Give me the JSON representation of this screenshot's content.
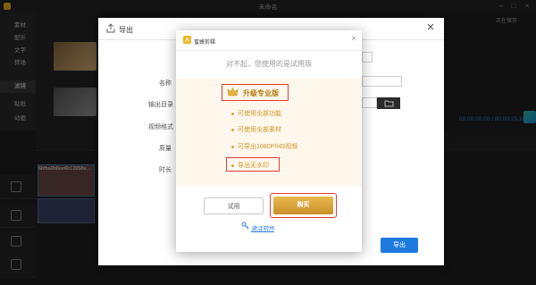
{
  "app": {
    "window_title": "未命名"
  },
  "sidebar": {
    "items": [
      {
        "label": "素材"
      },
      {
        "label": "配乐"
      },
      {
        "label": "文字"
      },
      {
        "label": "转场"
      },
      {
        "label": "滤镜"
      },
      {
        "label": "贴纸"
      },
      {
        "label": "动画"
      }
    ]
  },
  "right_panel": {
    "save_label": "正在保存",
    "time_label": "00:00:00.00 / 00:00:25.10"
  },
  "timeline": {
    "clip_name": "6bfba9b8ee6b12858e..."
  },
  "export_dialog": {
    "title": "导出",
    "fields": [
      {
        "label": "名称"
      },
      {
        "label": "输出目录"
      },
      {
        "label": "视频格式"
      },
      {
        "label": "质量"
      },
      {
        "label": "时长"
      }
    ],
    "export_button": "导出"
  },
  "upgrade_popup": {
    "app_name": "蜜蜂剪辑",
    "message": "对不起，您使用的是试用版",
    "upgrade_title": "升级专业版",
    "features": [
      "可使用全部功能",
      "可使用全部素材",
      "可导出1080P/HD视频",
      "导出无水印"
    ],
    "trial_button": "试用",
    "buy_button": "购买",
    "activate_link": "激活软件"
  },
  "colors": {
    "accent_gold": "#c9902a",
    "highlight_red": "#e53935",
    "link_blue": "#2a7ae0",
    "export_blue": "#1f7ae0"
  }
}
